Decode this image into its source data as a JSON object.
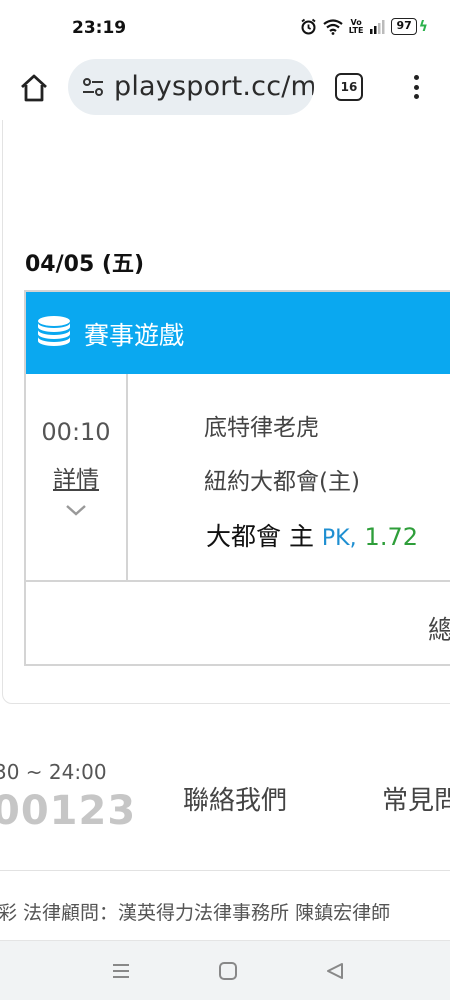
{
  "status_bar": {
    "time": "23:19",
    "volte": "Vo\nLTE",
    "battery": "97",
    "icons": [
      "alarm-icon",
      "wifi-icon",
      "volte-icon",
      "signal-icon",
      "battery-icon",
      "charging-icon"
    ]
  },
  "browser": {
    "url": "playsport.cc/m",
    "tab_count": "16",
    "icons": [
      "home-icon",
      "site-settings-icon",
      "tabs-icon",
      "more-vert-icon"
    ]
  },
  "schedule": {
    "date": "04/05 (五)",
    "section_title": "賽事遊戲",
    "section_icon": "coins-stack-icon",
    "accent_color": "#0aa8f0",
    "match": {
      "time": "00:10",
      "detail_link": "詳情",
      "away_team": "底特律老虎",
      "home_team": "紐約大都會(主)",
      "pick_team": "大都會 主",
      "pick_type": "PK,",
      "pick_odds": "1.72",
      "pick_type_color": "#1f8fd1",
      "pick_odds_color": "#2e9e3a"
    },
    "total_label": "總"
  },
  "footer": {
    "hours": "30 ~ 24:00",
    "phone": "00123",
    "contact": "聯絡我們",
    "faq": "常見問",
    "legal": "彩 法律顧問：漢英得力法律事務所 陳鎮宏律師"
  },
  "nav_bar": {
    "icons": [
      "recents-icon",
      "home-circle-icon",
      "back-icon"
    ]
  }
}
